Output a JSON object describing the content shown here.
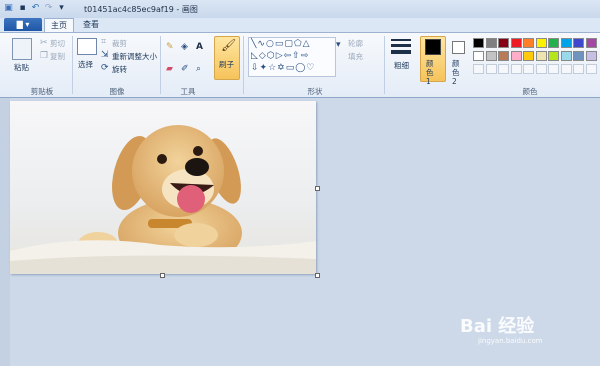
{
  "window": {
    "title": "t01451ac4c85ec9af19 - 画图"
  },
  "quick_access": [
    "paint-logo-icon",
    "save-icon",
    "undo-icon",
    "redo-icon",
    "customize-icon"
  ],
  "tabs": {
    "file": "▇ ▾",
    "home": "主页",
    "view": "查看"
  },
  "clipboard": {
    "paste": "粘贴",
    "cut": "剪切",
    "copy": "复制",
    "group": "剪贴板"
  },
  "image": {
    "select": "选择",
    "crop": "裁剪",
    "resize": "重新调整大小",
    "rotate": "旋转",
    "group": "图像"
  },
  "tools": {
    "group": "工具"
  },
  "brush": {
    "label": "刷子"
  },
  "shapes": {
    "outline": "轮廓",
    "fill": "填充",
    "group": "形状"
  },
  "size": {
    "label": "粗细"
  },
  "colors": {
    "color1": "颜色 1",
    "color2": "颜色 2",
    "group": "颜色",
    "row1": [
      "#000000",
      "#7f7f7f",
      "#880015",
      "#ed1c24",
      "#ff7f27",
      "#fff200",
      "#22b14c",
      "#00a2e8",
      "#3f48cc",
      "#a349a4"
    ],
    "row2": [
      "#ffffff",
      "#c3c3c3",
      "#b97a57",
      "#ffaec9",
      "#ffc90e",
      "#efe4b0",
      "#b5e61d",
      "#99d9ea",
      "#7092be",
      "#c8bfe7"
    ]
  },
  "watermark": {
    "brand": "Bai 经验",
    "url": "jingyan.baidu.com"
  }
}
